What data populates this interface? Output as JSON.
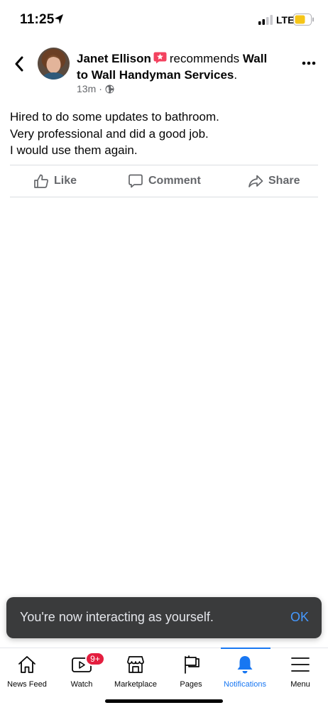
{
  "status_bar": {
    "time": "11:25",
    "network": "LTE",
    "icons": [
      "location-arrow-icon",
      "signal-icon",
      "battery-icon"
    ]
  },
  "post": {
    "author": "Janet Ellison",
    "verb": "recommends",
    "page_name_line1": "Wall",
    "page_name_line2": "to Wall Handyman Services",
    "page_suffix": ".",
    "time_ago": "13m",
    "meta_separator": "·",
    "text_lines": [
      "Hired to do some updates to bathroom.",
      "Very professional and did a good job.",
      "I would use them again."
    ]
  },
  "actions": {
    "like_label": "Like",
    "comment_label": "Comment",
    "share_label": "Share"
  },
  "toast": {
    "message": "You're now interacting as yourself.",
    "ok_label": "OK"
  },
  "tabs": [
    {
      "label": "News Feed",
      "icon": "home-icon"
    },
    {
      "label": "Watch",
      "icon": "watch-icon",
      "badge": "9+"
    },
    {
      "label": "Marketplace",
      "icon": "marketplace-icon"
    },
    {
      "label": "Pages",
      "icon": "flag-icon"
    },
    {
      "label": "Notifications",
      "icon": "bell-icon",
      "active": true
    },
    {
      "label": "Menu",
      "icon": "hamburger-icon"
    }
  ],
  "colors": {
    "accent": "#1877f2",
    "recommend_icon": "#f3425f",
    "badge": "#e41e3f",
    "toast_bg": "#3a3b3c",
    "toast_ok": "#4599ff",
    "secondary_text": "#65676b"
  }
}
